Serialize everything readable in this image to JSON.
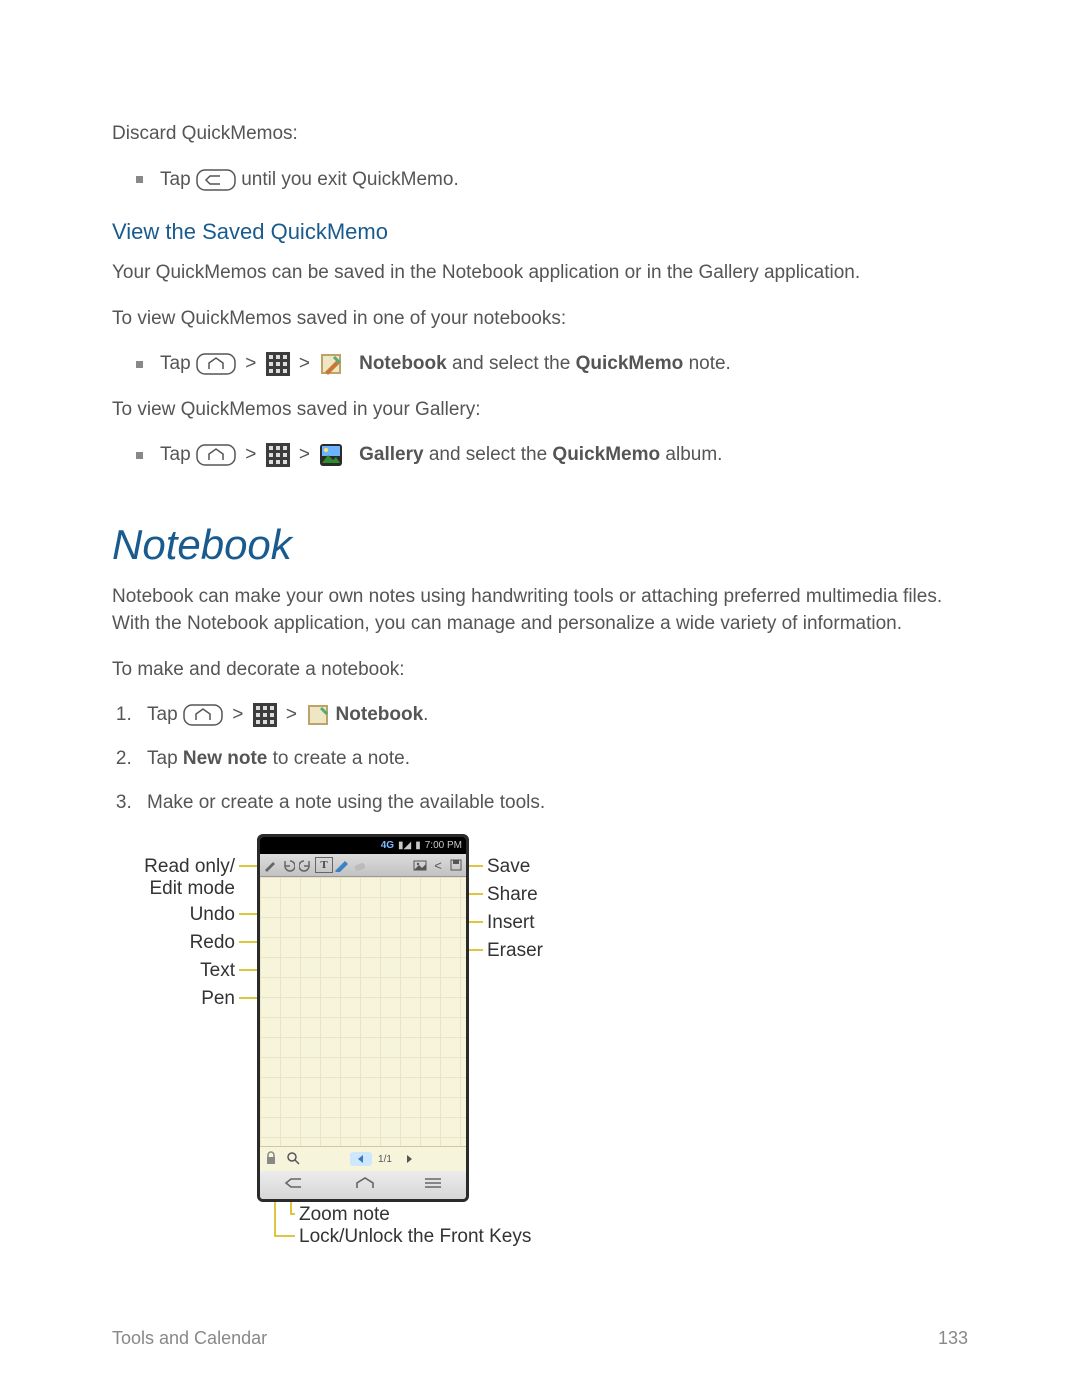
{
  "discard_title": "Discard QuickMemos:",
  "discard_bullet_pre": "Tap ",
  "discard_bullet_post": " until you exit QuickMemo.",
  "subheading1": "View the Saved QuickMemo",
  "p1": "Your QuickMemos can be saved in the Notebook application or in the Gallery application.",
  "p2": "To view QuickMemos saved in one of your notebooks:",
  "nb_bullet_pre": "Tap ",
  "gt": ">",
  "nb_label": "Notebook",
  "nb_bullet_mid": " and select the ",
  "nb_qm": "QuickMemo",
  "nb_bullet_post": " note.",
  "p3": "To view QuickMemos saved in your Gallery:",
  "gal_label": "Gallery",
  "gal_bullet_mid": " and select the ",
  "gal_bullet_post": " album.",
  "heading2": "Notebook",
  "p4": "Notebook can make your own notes using handwriting tools or attaching preferred multimedia files. With the Notebook application, you can manage and personalize a wide variety of information.",
  "p5": "To make and decorate a notebook:",
  "step1_pre": "Tap ",
  "step1_nb": "Notebook",
  "step1_post": ".",
  "step2_pre": "Tap ",
  "step2_bold": "New note",
  "step2_post": " to create a note.",
  "step3": "Make or create a note using the available tools.",
  "fig": {
    "time": "7:00 PM",
    "pager": "1/1",
    "left": {
      "read_edit1": "Read only/",
      "read_edit2": "Edit mode",
      "undo": "Undo",
      "redo": "Redo",
      "text": "Text",
      "pen": "Pen"
    },
    "right": {
      "save": "Save",
      "share": "Share",
      "insert": "Insert",
      "eraser": "Eraser"
    },
    "bottom": {
      "zoom": "Zoom note",
      "lock": "Lock/Unlock the Front Keys"
    }
  },
  "footer_left": "Tools and Calendar",
  "footer_right": "133"
}
